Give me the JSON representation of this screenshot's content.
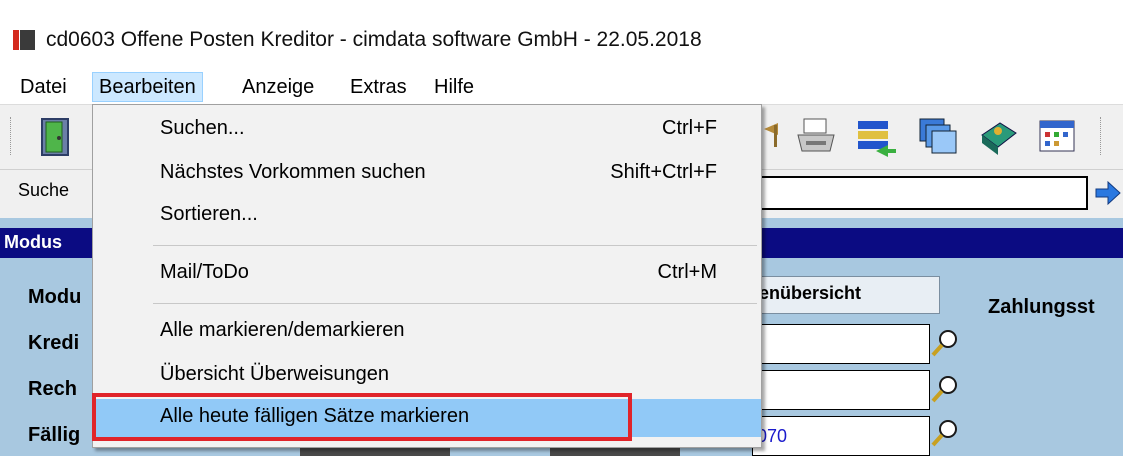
{
  "window": {
    "title": "cd0603 Offene Posten Kreditor - cimdata software GmbH - 22.05.2018"
  },
  "menubar": {
    "items": [
      "Datei",
      "Bearbeiten",
      "Anzeige",
      "Extras",
      "Hilfe"
    ]
  },
  "search": {
    "label": "Suche"
  },
  "form": {
    "band_label": "Modus",
    "labels": [
      "Modu",
      "Kredi",
      "Rech",
      "Fällig"
    ],
    "overview_button": "enübersicht",
    "zahlung_label": "Zahlungsst",
    "due_field_value": "070"
  },
  "dropdown": {
    "items": [
      {
        "label": "Suchen...",
        "shortcut": "Ctrl+F"
      },
      {
        "label": "Nächstes Vorkommen suchen",
        "shortcut": "Shift+Ctrl+F"
      },
      {
        "label": "Sortieren...",
        "shortcut": ""
      },
      {
        "label": "Mail/ToDo",
        "shortcut": "Ctrl+M"
      },
      {
        "label": "Alle markieren/demarkieren",
        "shortcut": ""
      },
      {
        "label": "Übersicht Überweisungen",
        "shortcut": ""
      },
      {
        "label": "Alle heute fälligen Sätze markieren",
        "shortcut": ""
      }
    ],
    "highlighted_index": 6
  },
  "colors": {
    "menu_hover": "#cce8ff",
    "item_highlight": "#91c9f7",
    "annotation_red": "#e0242a",
    "band_navy": "#0b0b82",
    "content_bg": "#a8c8e0"
  },
  "icons": [
    "exit-door-icon",
    "print-icon",
    "transfer-icon",
    "windows-icon",
    "book-icon",
    "table-icon",
    "magnifier-icon",
    "arrow-right-icon"
  ]
}
